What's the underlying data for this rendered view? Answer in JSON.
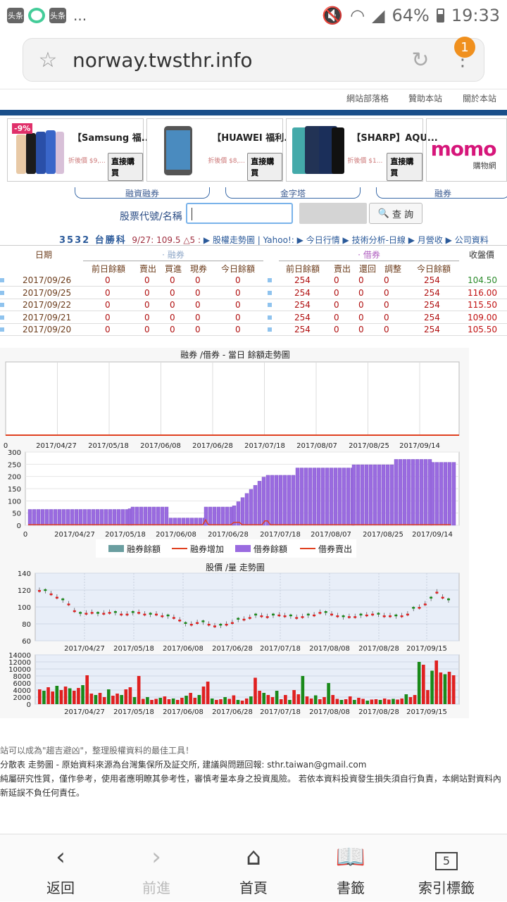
{
  "status_bar": {
    "apps": [
      "头条",
      "",
      "头条"
    ],
    "more": "...",
    "battery": "64%",
    "time": "19:33"
  },
  "browser": {
    "url": "norway.twsthr.info",
    "badge_count": "1"
  },
  "topnav": [
    "網站部落格",
    "贊助本站",
    "關於本站"
  ],
  "ads": [
    {
      "title": "【Samsung 福...",
      "price": "折後價 $9,...",
      "buy": "直接購買",
      "discount": "-9%"
    },
    {
      "title": "【HUAWEI 福利...",
      "price": "折後價 $8,...",
      "buy": "直接購買"
    },
    {
      "title": "【SHARP】AQU...",
      "price": "折後價 $1...",
      "buy": "直接購買"
    }
  ],
  "momo": {
    "logo": "momo",
    "sub": "購物網"
  },
  "tabs": [
    "融資融券",
    "金字塔",
    "融券"
  ],
  "search": {
    "label": "股票代號/名稱",
    "button": "查 詢",
    "value": ""
  },
  "stock_info": {
    "code_name": "3532 台勝科",
    "price": "9/27: 109.5 △5 :",
    "links": [
      "股權走勢圖",
      "Yahoo!:",
      "今日行情",
      "技術分析-日線",
      "月營收",
      "公司資料"
    ]
  },
  "table": {
    "h_date": "日期",
    "h_short": "融券",
    "h_borrow": "借券",
    "h_close": "收盤價",
    "sub_short": [
      "前日餘額",
      "賣出",
      "買進",
      "現券",
      "今日餘額"
    ],
    "sub_borrow": [
      "前日餘額",
      "賣出",
      "還回",
      "調整",
      "今日餘額"
    ],
    "rows": [
      {
        "date": "2017/09/26",
        "s": [
          "0",
          "0",
          "0",
          "0",
          "0"
        ],
        "b": [
          "254",
          "0",
          "0",
          "0",
          "254"
        ],
        "close": "104.50",
        "up": true
      },
      {
        "date": "2017/09/25",
        "s": [
          "0",
          "0",
          "0",
          "0",
          "0"
        ],
        "b": [
          "254",
          "0",
          "0",
          "0",
          "254"
        ],
        "close": "116.00",
        "up": false
      },
      {
        "date": "2017/09/22",
        "s": [
          "0",
          "0",
          "0",
          "0",
          "0"
        ],
        "b": [
          "254",
          "0",
          "0",
          "0",
          "254"
        ],
        "close": "115.50",
        "up": false
      },
      {
        "date": "2017/09/21",
        "s": [
          "0",
          "0",
          "0",
          "0",
          "0"
        ],
        "b": [
          "254",
          "0",
          "0",
          "0",
          "254"
        ],
        "close": "109.00",
        "up": false
      },
      {
        "date": "2017/09/20",
        "s": [
          "0",
          "0",
          "0",
          "0",
          "0"
        ],
        "b": [
          "254",
          "0",
          "0",
          "0",
          "254"
        ],
        "close": "105.50",
        "up": false
      }
    ]
  },
  "chart_data": [
    {
      "type": "line",
      "title": "融券 /借券 - 當日 餘額走勢圖",
      "categories": [
        "2017/04/27",
        "2017/05/18",
        "2017/06/08",
        "2017/06/28",
        "2017/07/18",
        "2017/08/07",
        "2017/08/25",
        "2017/09/14"
      ],
      "series": [
        {
          "name": "融券餘額",
          "values": [
            0,
            0,
            0,
            0,
            0,
            0,
            0,
            0
          ]
        }
      ]
    },
    {
      "type": "bar",
      "categories": [
        "2017/04/27",
        "2017/05/18",
        "2017/06/08",
        "2017/06/28",
        "2017/07/18",
        "2017/08/07",
        "2017/08/25",
        "2017/09/14"
      ],
      "ylim": [
        0,
        300
      ],
      "series": [
        {
          "name": "借券餘額",
          "values": [
            65,
            65,
            75,
            30,
            100,
            205,
            235,
            248,
            270
          ]
        },
        {
          "name": "借券賣出",
          "values": [
            0,
            0,
            0,
            0,
            25,
            0,
            0,
            0,
            0
          ]
        },
        {
          "name": "融券餘額",
          "values": []
        },
        {
          "name": "融券增加",
          "values": []
        }
      ],
      "legend": [
        "融券餘額",
        "融券增加",
        "借券餘額",
        "借券賣出"
      ]
    },
    {
      "type": "line",
      "title": "股價 /量 走勢圖",
      "categories": [
        "2017/04/27",
        "2017/05/18",
        "2017/06/08",
        "2017/06/28",
        "2017/07/18",
        "2017/08/08",
        "2017/08/28",
        "2017/09/15"
      ],
      "ylim": [
        60,
        140
      ],
      "series": [
        {
          "name": "price",
          "values": [
            120,
            92,
            92,
            80,
            78,
            90,
            93,
            88,
            90,
            100,
            118,
            108
          ]
        }
      ]
    },
    {
      "type": "bar",
      "categories": [
        "2017/04/27",
        "2017/05/18",
        "2017/06/08",
        "2017/06/28",
        "2017/07/18",
        "2017/08/08",
        "2017/08/28",
        "2017/09/15"
      ],
      "ylim": [
        0,
        14000
      ],
      "series": [
        {
          "name": "volume",
          "values": [
            4200,
            8000,
            3000,
            7800,
            2000,
            6400,
            1500,
            7500,
            3800,
            8000,
            2500,
            6000,
            1500,
            12000,
            9500,
            8500
          ]
        }
      ]
    }
  ],
  "chart_labels": {
    "chart1_title": "融券 /借券 - 當日 餘額走勢圖",
    "chart3_title": "股價 /量 走勢圖",
    "x1": [
      "0",
      "2017/04/27",
      "2017/05/18",
      "2017/06/08",
      "2017/06/28",
      "2017/07/18",
      "2017/08/07",
      "2017/08/25",
      "2017/09/14"
    ],
    "y2": [
      "300",
      "250",
      "200",
      "150",
      "100",
      "50",
      "0"
    ],
    "x2": [
      "0",
      "2017/04/27",
      "2017/05/18",
      "2017/06/08",
      "2017/06/28",
      "2017/07/18",
      "2017/08/07",
      "2017/08/25",
      "2017/09/14"
    ],
    "legend": [
      "融券餘額",
      "融券增加",
      "借券餘額",
      "借券賣出"
    ],
    "y3": [
      "140",
      "120",
      "100",
      "80",
      "60"
    ],
    "x3": [
      "2017/04/27",
      "2017/05/18",
      "2017/06/08",
      "2017/06/28",
      "2017/07/18",
      "2017/08/08",
      "2017/08/28",
      "2017/09/15"
    ],
    "y4": [
      "14000",
      "12000",
      "10000",
      "8000",
      "6000",
      "4000",
      "2000",
      "0"
    ]
  },
  "footer": {
    "line1": "站可以成為\"趨吉避凶\"，整理股權資料的最佳工具！",
    "line2": "分散表 走勢圖 - 原始資料來源為台灣集保所及証交所, 建議與問題回報: sthr.taiwan@gmail.com",
    "line3": "純屬研究性質，僅作參考，使用者應明瞭其參考性，審慎考量本身之投資風險。 若依本資料投資發生損失須自行負責，本網站對資料內",
    "line4": "新延誤不負任何責任。"
  },
  "bottom_nav": [
    {
      "label": "返回",
      "icon": "back-icon",
      "disabled": false
    },
    {
      "label": "前進",
      "icon": "forward-icon",
      "disabled": true
    },
    {
      "label": "首頁",
      "icon": "home-icon",
      "disabled": false
    },
    {
      "label": "書籤",
      "icon": "bookmark-icon",
      "disabled": false
    },
    {
      "label": "索引標籤",
      "icon": "tabs-icon",
      "tab_count": "5",
      "disabled": false
    }
  ]
}
